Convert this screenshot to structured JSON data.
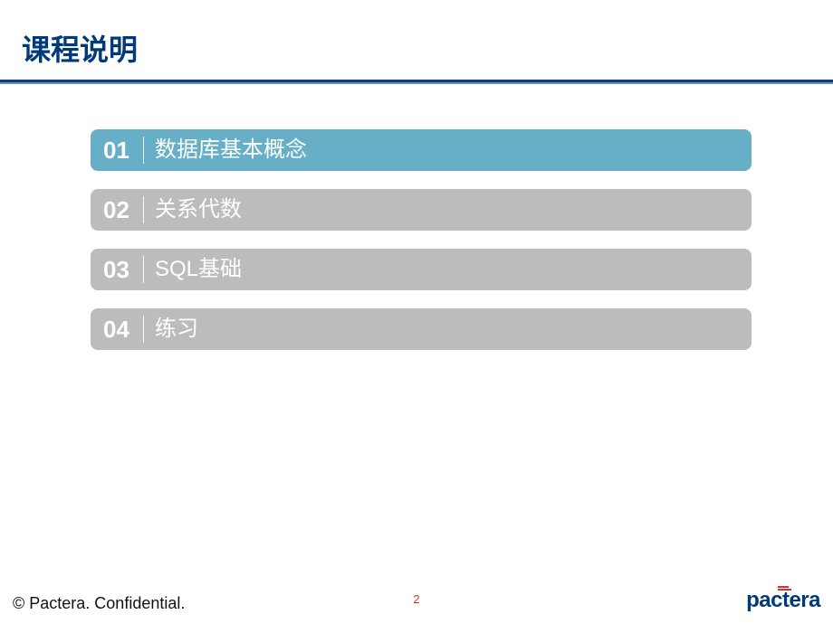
{
  "title": "课程说明",
  "toc": [
    {
      "num": "01",
      "label": "数据库基本概念",
      "active": true
    },
    {
      "num": "02",
      "label": "关系代数",
      "active": false
    },
    {
      "num": "03",
      "label": "SQL基础",
      "active": false
    },
    {
      "num": "04",
      "label": "练习",
      "active": false
    }
  ],
  "footer_left": "© Pactera. Confidential.",
  "page_number": "2",
  "logo_text": "pactera"
}
